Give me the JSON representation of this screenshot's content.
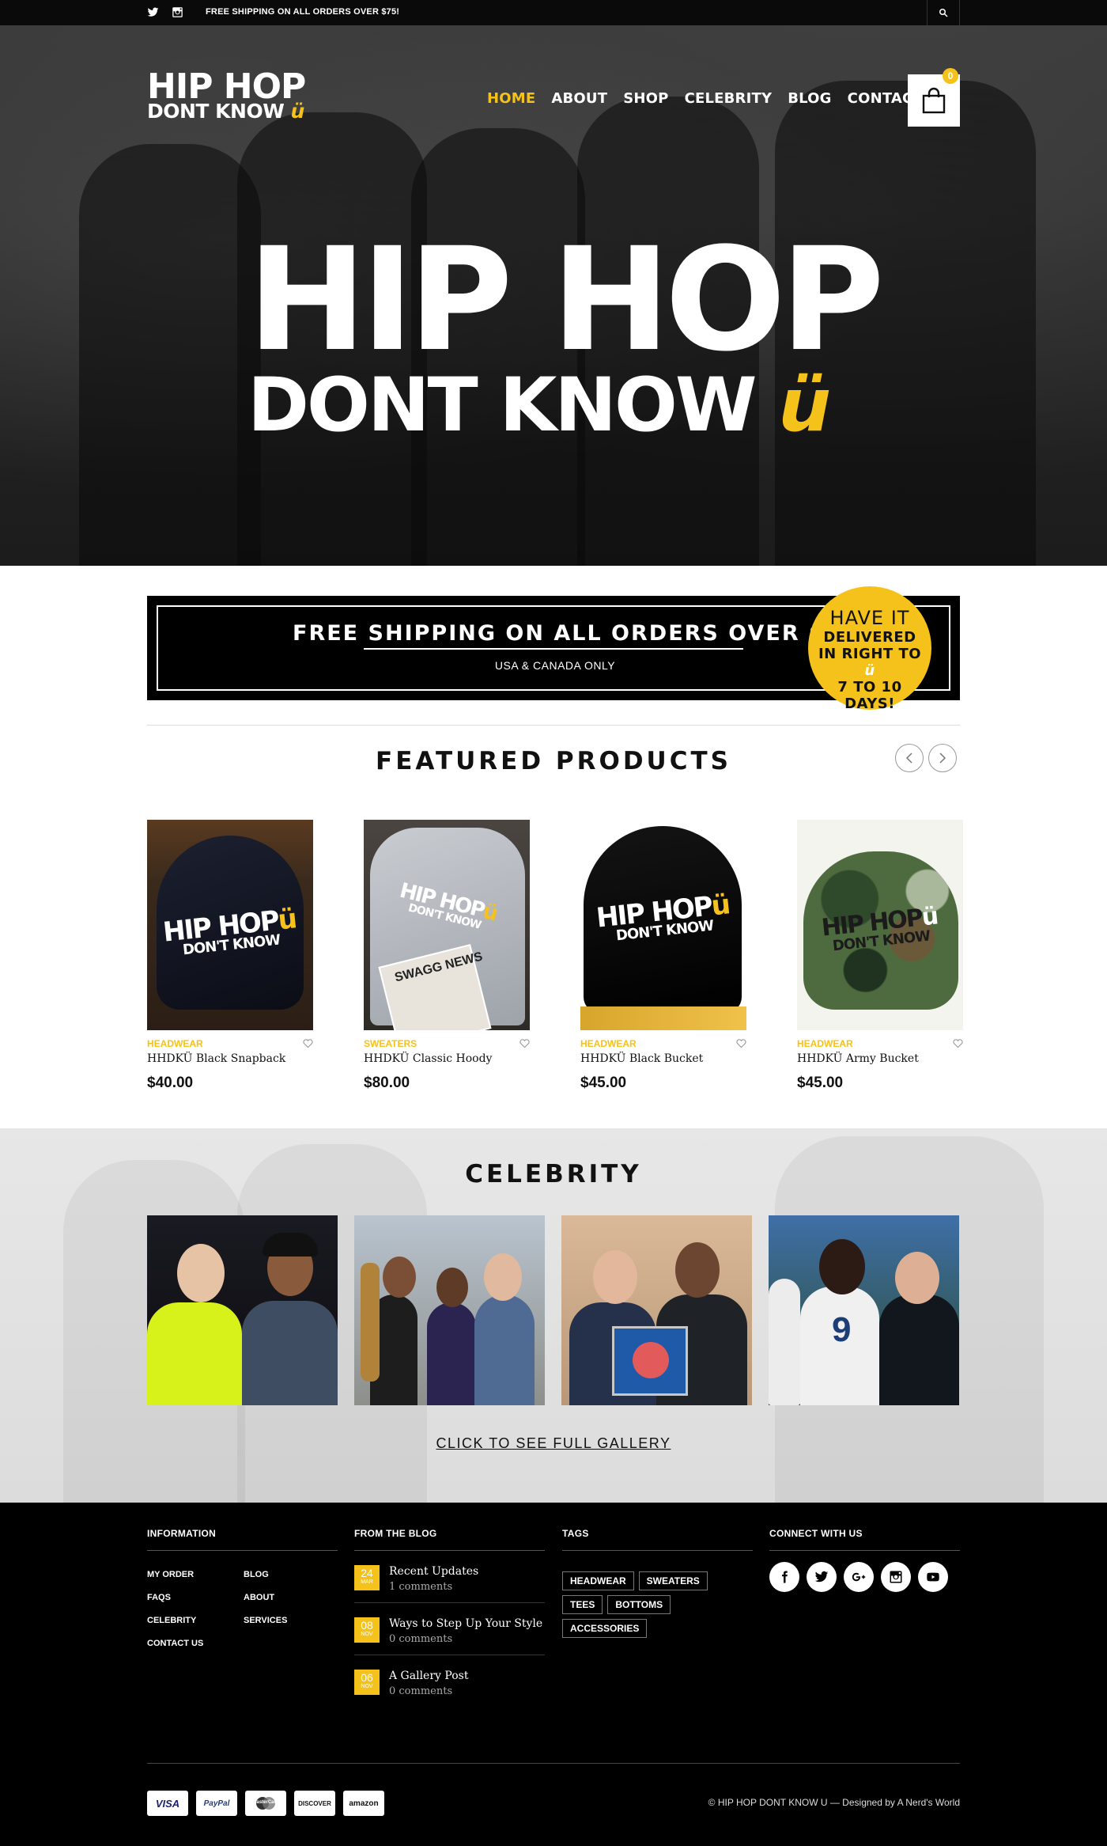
{
  "topbar": {
    "shipping_text": "FREE SHIPPING ON ALL ORDERS OVER $75!",
    "social_icons": [
      "twitter-icon",
      "instagram-icon"
    ],
    "search_icon": "search-icon"
  },
  "header": {
    "logo_line1": "HIP HOP",
    "logo_line2": "DONT KNOW",
    "logo_u": "ü",
    "nav": [
      "HOME",
      "ABOUT",
      "SHOP",
      "CELEBRITY",
      "BLOG",
      "CONTACT"
    ],
    "active_nav": "HOME",
    "cart_count": "0"
  },
  "hero": {
    "title_line1": "HIP HOP",
    "title_line2": "DONT KNOW",
    "title_u": "ü"
  },
  "shipping_banner": {
    "headline": "FREE SHIPPING ON ALL ORDERS OVER $75",
    "subline": "USA & CANADA ONLY",
    "badge_top": "HAVE IT",
    "badge_mid": "DELIVERED IN RIGHT TO",
    "badge_u": "ü",
    "badge_bottom": "7 TO 10 DAYS!"
  },
  "featured": {
    "title": "FEATURED PRODUCTS",
    "products": [
      {
        "category": "HEADWEAR",
        "name": "HHDKÜ Black Snapback",
        "price": "$40.00"
      },
      {
        "category": "SWEATERS",
        "name": "HHDKÜ Classic Hoody",
        "price": "$80.00"
      },
      {
        "category": "HEADWEAR",
        "name": "HHDKÜ Black Bucket",
        "price": "$45.00"
      },
      {
        "category": "HEADWEAR",
        "name": "HHDKÜ Army Bucket",
        "price": "$45.00"
      }
    ],
    "hat_print_top": "HIP HOP",
    "hat_print_bottom": "DON'T KNOW",
    "hoody_magazine": "SWAGG NEWS"
  },
  "celebrity": {
    "title": "CELEBRITY",
    "gallery_link": "CLICK TO SEE FULL GALLERY"
  },
  "footer": {
    "information": {
      "heading": "INFORMATION",
      "links": [
        "MY ORDER",
        "BLOG",
        "FAQS",
        "ABOUT",
        "CELEBRITY",
        "SERVICES",
        "CONTACT US"
      ]
    },
    "blog": {
      "heading": "FROM THE BLOG",
      "posts": [
        {
          "day": "24",
          "month": "MAR",
          "title": "Recent Updates",
          "comments": "1 comments"
        },
        {
          "day": "08",
          "month": "NOV",
          "title": "Ways to Step Up Your Style",
          "comments": "0 comments"
        },
        {
          "day": "06",
          "month": "NOV",
          "title": "A Gallery Post",
          "comments": "0 comments"
        }
      ]
    },
    "tags": {
      "heading": "TAGS",
      "items": [
        "HEADWEAR",
        "SWEATERS",
        "TEES",
        "BOTTOMS",
        "ACCESSORIES"
      ]
    },
    "connect": {
      "heading": "CONNECT WITH US",
      "icons": [
        "facebook-icon",
        "twitter-icon",
        "google-plus-icon",
        "instagram-icon",
        "youtube-icon"
      ]
    },
    "payments": [
      "VISA",
      "PayPal",
      "MasterCard",
      "DISCOVER",
      "amazon"
    ],
    "copyright": "© HIP HOP DONT KNOW U — Designed by A Nerd's World"
  },
  "colors": {
    "accent": "#f5c21b",
    "dark": "#000000"
  }
}
